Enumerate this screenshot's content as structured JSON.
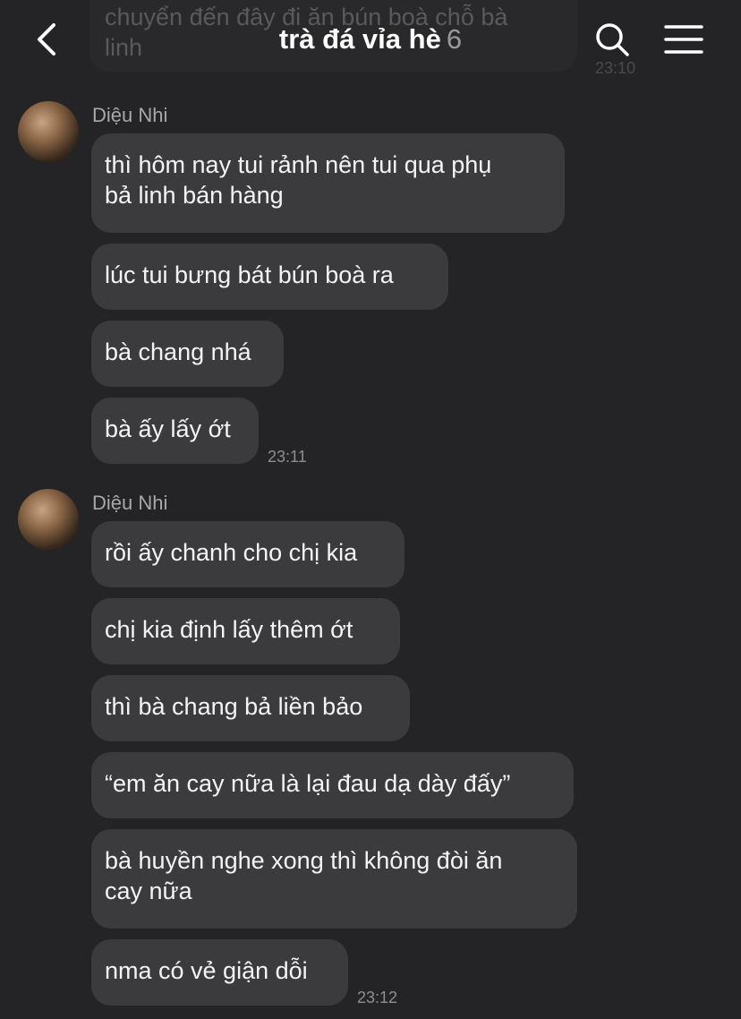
{
  "header": {
    "title": "trà đá vỉa hè",
    "member_count": "6",
    "back_icon": "chevron-left-icon",
    "search_icon": "search-icon",
    "menu_icon": "hamburger-menu-icon"
  },
  "previous_message": {
    "text": "chuyển đến đây đi ăn bún boà chỗ bà\nlinh",
    "time": "23:10"
  },
  "groups": [
    {
      "sender": "Diệu Nhi",
      "messages": [
        "thì hôm nay tui rảnh nên tui qua phụ\nbả linh bán hàng",
        "lúc tui bưng bát bún boà ra",
        "bà chang nhá",
        "bà ấy lấy ớt"
      ],
      "time": "23:11"
    },
    {
      "sender": "Diệu Nhi",
      "messages": [
        "rồi ấy chanh cho chị kia",
        "chị kia định lấy thêm ớt",
        "thì bà chang bả liền bảo",
        "“em ăn cay nữa là lại đau dạ dày đấy”",
        "bà huyền nghe xong thì không đòi ăn\ncay nữa",
        "nma có vẻ giận dỗi"
      ],
      "time": "23:12"
    }
  ],
  "colors": {
    "background": "#242426",
    "bubble": "#3b3b3e",
    "text": "#f4f4f4",
    "muted": "#a8a8aa"
  }
}
